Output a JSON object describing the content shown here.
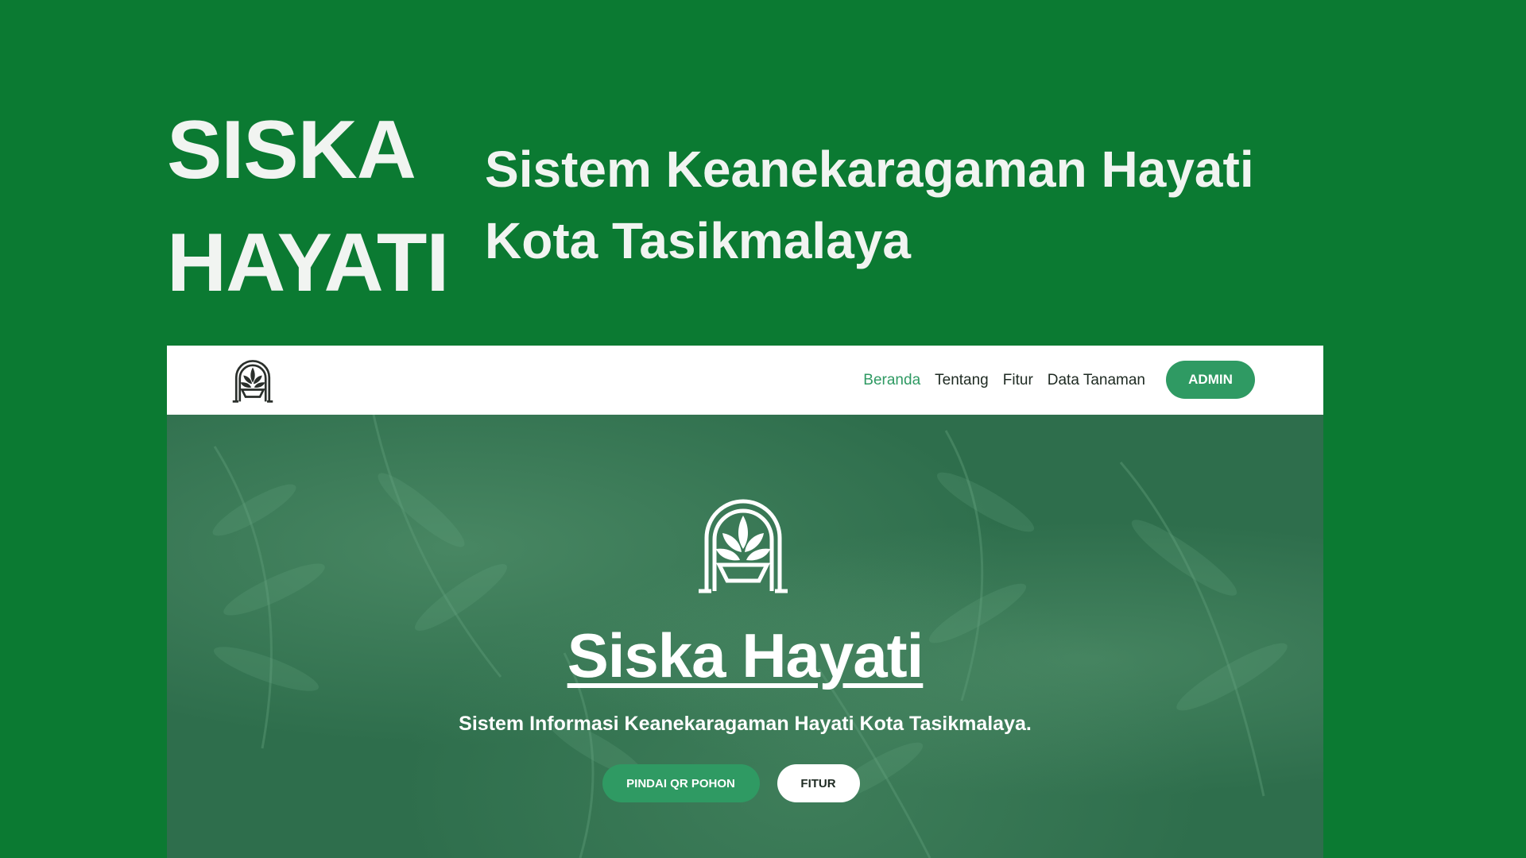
{
  "banner": {
    "headline_line1": "SISKA",
    "headline_line2": "HAYATI",
    "tagline_line1": "Sistem Keanekaragaman Hayati",
    "tagline_line2": "Kota Tasikmalaya"
  },
  "navbar": {
    "logo_icon": "plant-pot-logo-icon",
    "links": [
      {
        "label": "Beranda",
        "active": true
      },
      {
        "label": "Tentang",
        "active": false
      },
      {
        "label": "Fitur",
        "active": false
      },
      {
        "label": "Data Tanaman",
        "active": false
      }
    ],
    "admin_label": "ADMIN"
  },
  "hero": {
    "logo_icon": "plant-pot-logo-icon",
    "title": "Siska Hayati",
    "subtitle": "Sistem Informasi Keanekaragaman Hayati Kota Tasikmalaya.",
    "primary_button": "PINDAI QR POHON",
    "secondary_button": "FITUR"
  },
  "colors": {
    "background": "#0b7a32",
    "accent": "#2f9a63",
    "hero_overlay": "#2e6e4c"
  }
}
